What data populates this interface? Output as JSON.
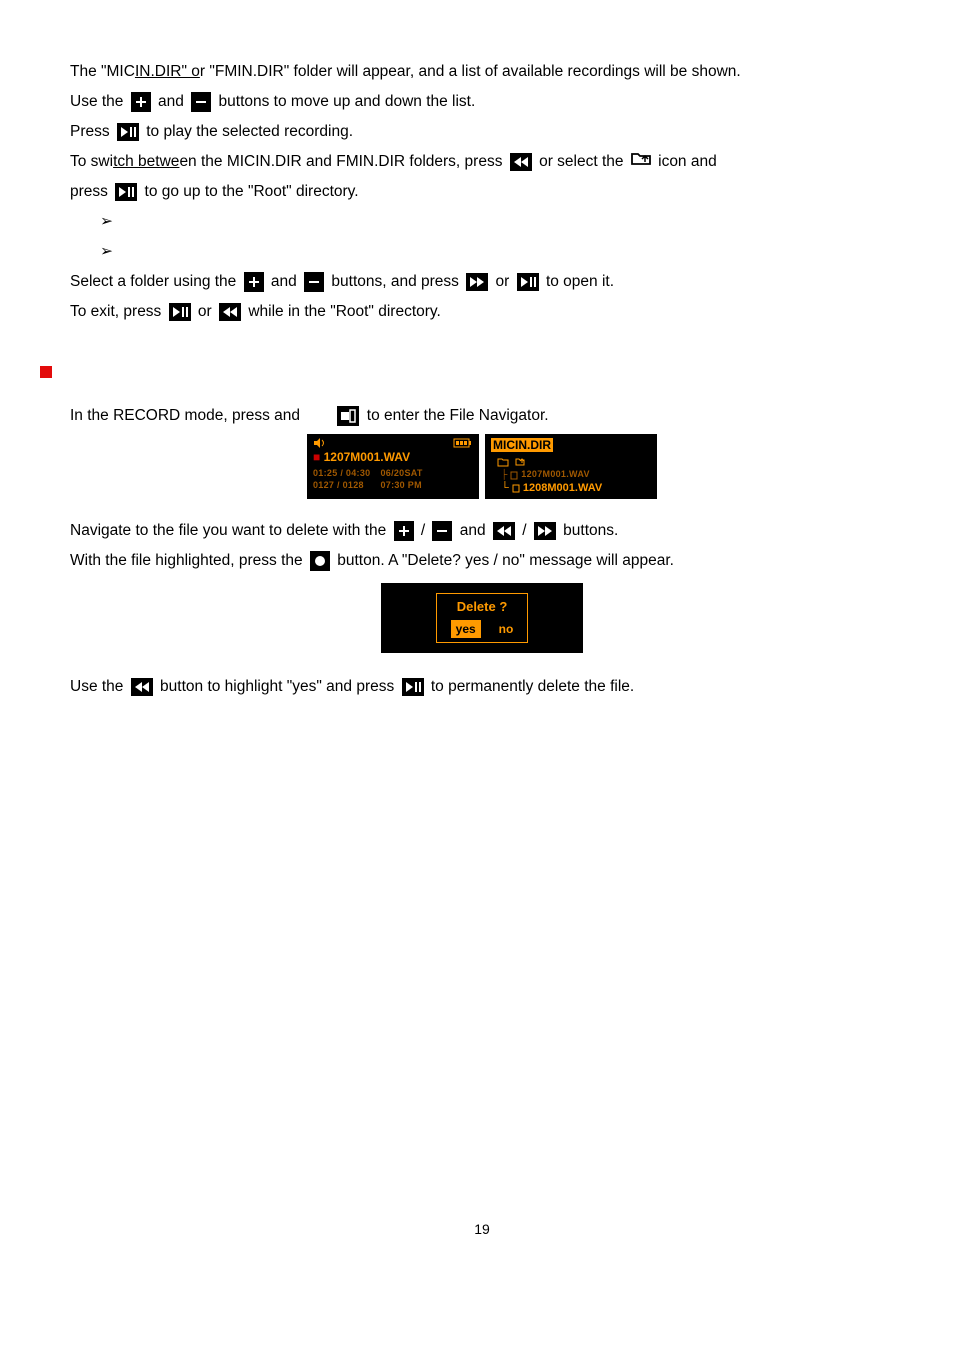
{
  "para1_a": "The \"MIC",
  "para1_b": "IN.DIR\" o",
  "para1_c": "r \"FMIN.DIR\" folder will appear, and a list of available recordings will be shown.",
  "para2_a": "Use the ",
  "para2_b": " and ",
  "para2_c": " buttons to move up and down the list.",
  "para3_a": "Press ",
  "para3_b": " to play the selected recording.",
  "para4_a": "To swi",
  "para4_b": "tch betwe",
  "para4_c": "en the MICIN.DIR and FMIN.DIR folders, press ",
  "para4_d": " or select the ",
  "para4_e": " icon and",
  "para5_a": "press ",
  "para5_b": " to go up to the \"Root\" directory.",
  "para6_a": "Select a folder using the ",
  "para6_b": " and ",
  "para6_c": " buttons, and press ",
  "para6_d": " or ",
  "para6_e": " to open it.",
  "para7_a": "To exit, press ",
  "para7_b": " or ",
  "para7_c": " while in the \"Root\" directory.",
  "para8_a": "In the RECORD mode, press and ",
  "para8_b": " to enter the File Navigator.",
  "lcd_left_file": "1207M001.WAV",
  "lcd_left_t1": "01:25 / 04:30",
  "lcd_left_t2": "0127 / 0128",
  "lcd_left_d1": "06/20SAT",
  "lcd_left_d2": "07:30 PM",
  "lcd_right_dir": "MICIN.DIR",
  "lcd_right_f1": "1207M001.WAV",
  "lcd_right_f2": "1208M001.WAV",
  "para9_a": "Navigate to the file you want to delete with the ",
  "para9_b": " / ",
  "para9_c": " and ",
  "para9_d": " / ",
  "para9_e": " buttons.",
  "para10_a": "With the file highlighted, press the ",
  "para10_b": " button. A \"Delete? yes / no\" message will appear.",
  "delete_q": "Delete ?",
  "yes": "yes",
  "no": "no",
  "para11_a": "Use the ",
  "para11_b": " button to highlight \"yes\" and press ",
  "para11_c": " to permanently delete the file.",
  "page": "19"
}
